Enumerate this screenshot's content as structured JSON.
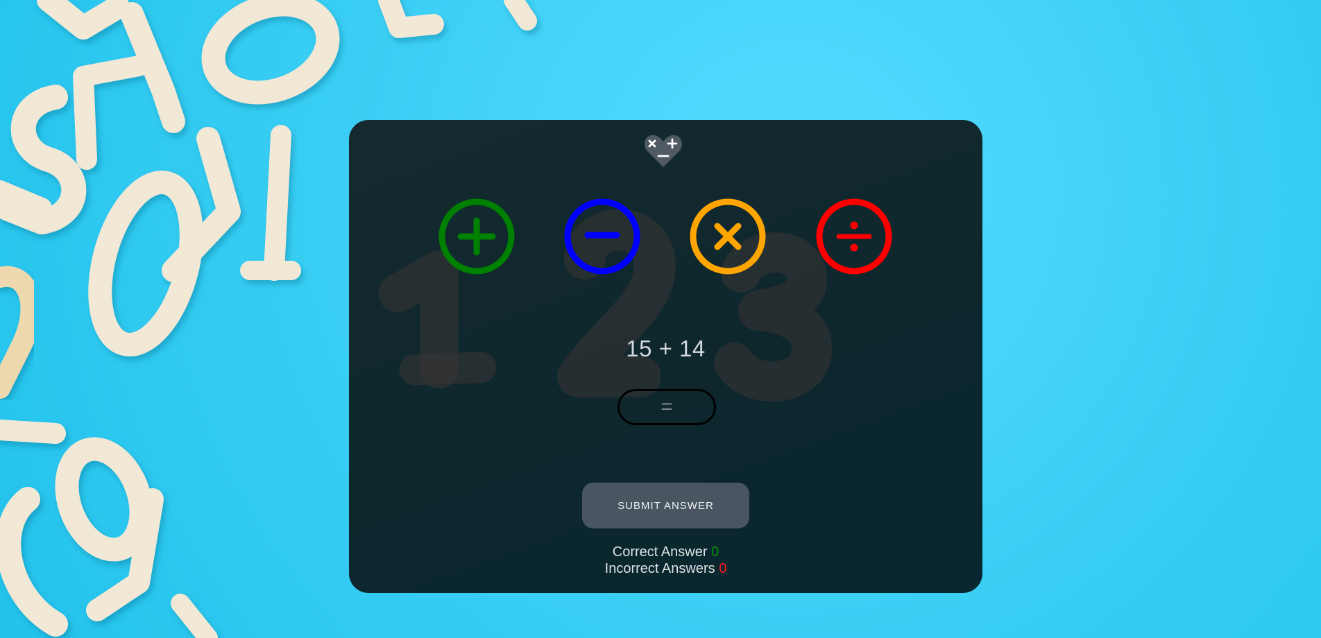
{
  "game": {
    "logo_icon": "math-operators-heart-icon",
    "operations": [
      {
        "name": "addition",
        "symbol": "plus-icon",
        "color": "#008000"
      },
      {
        "name": "subtraction",
        "symbol": "minus-icon",
        "color": "#0000ff"
      },
      {
        "name": "multiplication",
        "symbol": "times-icon",
        "color": "#ffa500"
      },
      {
        "name": "division",
        "symbol": "divide-icon",
        "color": "#ff0000"
      }
    ],
    "problem": "15 + 14",
    "answer_value": "",
    "answer_placeholder": "=",
    "submit_label": "SUBMIT ANSWER",
    "correct_label": "Correct Answer",
    "correct_count": "0",
    "incorrect_label": "Incorrect Answers",
    "incorrect_count": "0"
  },
  "colors": {
    "background": "#3ed0f2",
    "card": "#0d272d",
    "submit_button": "#4a5562",
    "correct": "#0a8f0a",
    "incorrect": "#ff1c1c"
  }
}
